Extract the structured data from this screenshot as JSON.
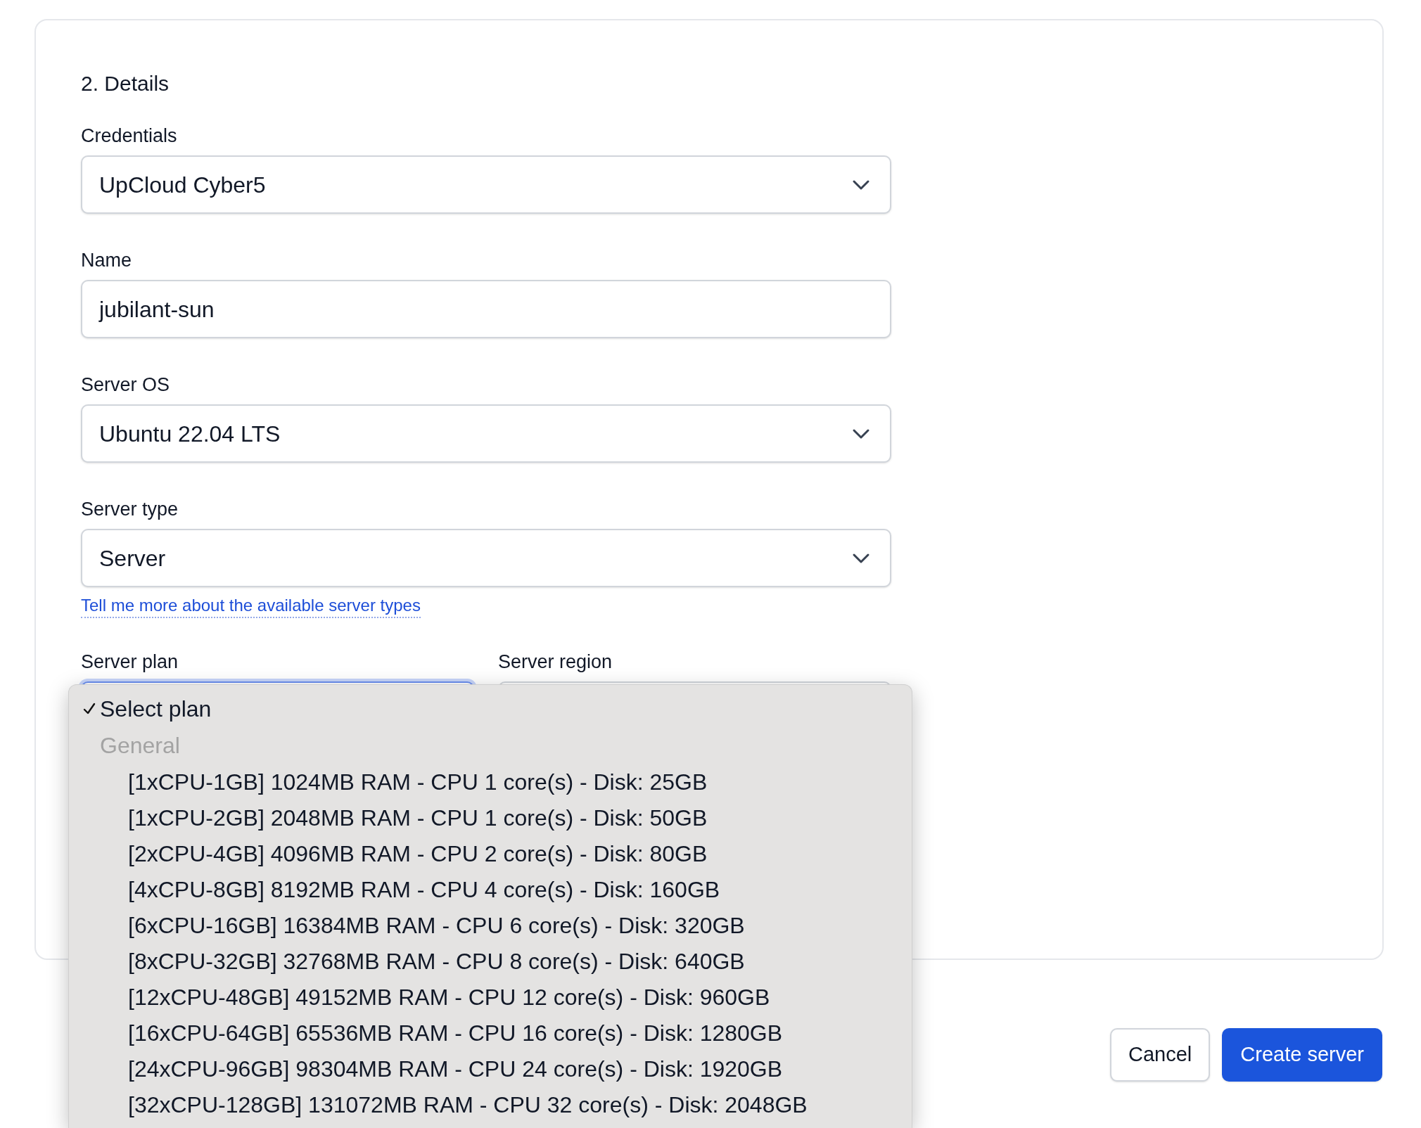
{
  "section_title": "2. Details",
  "fields": [
    {
      "kind": "select",
      "label": "Credentials",
      "value": "UpCloud Cyber5"
    },
    {
      "kind": "input",
      "label": "Name",
      "value": "jubilant-sun"
    },
    {
      "kind": "select",
      "label": "Server OS",
      "value": "Ubuntu 22.04 LTS"
    },
    {
      "kind": "select",
      "label": "Server type",
      "value": "Server",
      "link": "Tell me more about the available server types"
    }
  ],
  "server_plan": {
    "label": "Server plan",
    "focused": true
  },
  "server_region": {
    "label": "Server region"
  },
  "plan_dropdown": {
    "items": [
      {
        "kind": "option",
        "label": "Select plan",
        "selected": true
      },
      {
        "kind": "group",
        "label": "General",
        "children": [
          {
            "label": "[1xCPU-1GB] 1024MB RAM - CPU 1 core(s) - Disk: 25GB",
            "selected": false
          },
          {
            "label": "[1xCPU-2GB] 2048MB RAM - CPU 1 core(s) - Disk: 50GB",
            "selected": false
          },
          {
            "label": "[2xCPU-4GB] 4096MB RAM - CPU 2 core(s) - Disk: 80GB",
            "selected": false
          },
          {
            "label": "[4xCPU-8GB] 8192MB RAM - CPU 4 core(s) - Disk: 160GB",
            "selected": false
          },
          {
            "label": "[6xCPU-16GB] 16384MB RAM - CPU 6 core(s) - Disk: 320GB",
            "selected": false
          },
          {
            "label": "[8xCPU-32GB] 32768MB RAM - CPU 8 core(s) - Disk: 640GB",
            "selected": false
          },
          {
            "label": "[12xCPU-48GB] 49152MB RAM - CPU 12 core(s) - Disk: 960GB",
            "selected": false
          },
          {
            "label": "[16xCPU-64GB] 65536MB RAM - CPU 16 core(s) - Disk: 1280GB",
            "selected": false
          },
          {
            "label": "[24xCPU-96GB] 98304MB RAM - CPU 24 core(s) - Disk: 1920GB",
            "selected": false
          },
          {
            "label": "[32xCPU-128GB] 131072MB RAM - CPU 32 core(s) - Disk: 2048GB",
            "selected": false
          }
        ]
      }
    ]
  },
  "buttons": [
    {
      "kind": "secondary",
      "label": "Cancel"
    },
    {
      "kind": "primary",
      "label": "Create server"
    }
  ]
}
